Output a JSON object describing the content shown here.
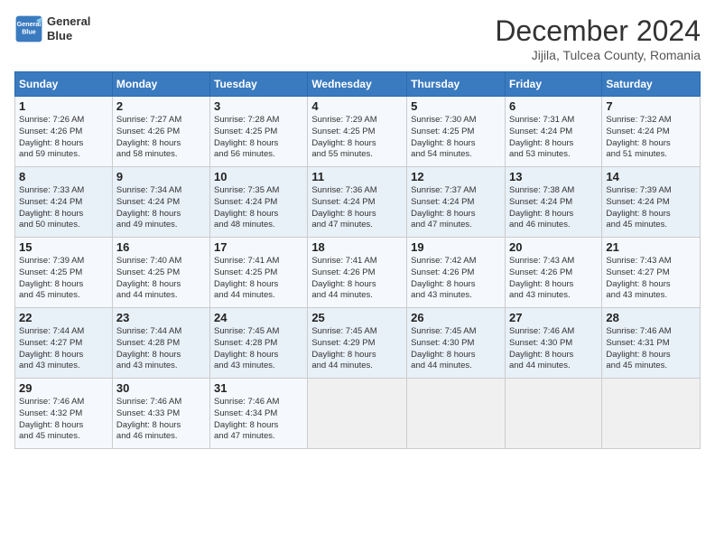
{
  "header": {
    "logo_line1": "General",
    "logo_line2": "Blue",
    "title": "December 2024",
    "subtitle": "Jijila, Tulcea County, Romania"
  },
  "days_of_week": [
    "Sunday",
    "Monday",
    "Tuesday",
    "Wednesday",
    "Thursday",
    "Friday",
    "Saturday"
  ],
  "weeks": [
    [
      {
        "day": "1",
        "info": "Sunrise: 7:26 AM\nSunset: 4:26 PM\nDaylight: 8 hours\nand 59 minutes."
      },
      {
        "day": "2",
        "info": "Sunrise: 7:27 AM\nSunset: 4:26 PM\nDaylight: 8 hours\nand 58 minutes."
      },
      {
        "day": "3",
        "info": "Sunrise: 7:28 AM\nSunset: 4:25 PM\nDaylight: 8 hours\nand 56 minutes."
      },
      {
        "day": "4",
        "info": "Sunrise: 7:29 AM\nSunset: 4:25 PM\nDaylight: 8 hours\nand 55 minutes."
      },
      {
        "day": "5",
        "info": "Sunrise: 7:30 AM\nSunset: 4:25 PM\nDaylight: 8 hours\nand 54 minutes."
      },
      {
        "day": "6",
        "info": "Sunrise: 7:31 AM\nSunset: 4:24 PM\nDaylight: 8 hours\nand 53 minutes."
      },
      {
        "day": "7",
        "info": "Sunrise: 7:32 AM\nSunset: 4:24 PM\nDaylight: 8 hours\nand 51 minutes."
      }
    ],
    [
      {
        "day": "8",
        "info": "Sunrise: 7:33 AM\nSunset: 4:24 PM\nDaylight: 8 hours\nand 50 minutes."
      },
      {
        "day": "9",
        "info": "Sunrise: 7:34 AM\nSunset: 4:24 PM\nDaylight: 8 hours\nand 49 minutes."
      },
      {
        "day": "10",
        "info": "Sunrise: 7:35 AM\nSunset: 4:24 PM\nDaylight: 8 hours\nand 48 minutes."
      },
      {
        "day": "11",
        "info": "Sunrise: 7:36 AM\nSunset: 4:24 PM\nDaylight: 8 hours\nand 47 minutes."
      },
      {
        "day": "12",
        "info": "Sunrise: 7:37 AM\nSunset: 4:24 PM\nDaylight: 8 hours\nand 47 minutes."
      },
      {
        "day": "13",
        "info": "Sunrise: 7:38 AM\nSunset: 4:24 PM\nDaylight: 8 hours\nand 46 minutes."
      },
      {
        "day": "14",
        "info": "Sunrise: 7:39 AM\nSunset: 4:24 PM\nDaylight: 8 hours\nand 45 minutes."
      }
    ],
    [
      {
        "day": "15",
        "info": "Sunrise: 7:39 AM\nSunset: 4:25 PM\nDaylight: 8 hours\nand 45 minutes."
      },
      {
        "day": "16",
        "info": "Sunrise: 7:40 AM\nSunset: 4:25 PM\nDaylight: 8 hours\nand 44 minutes."
      },
      {
        "day": "17",
        "info": "Sunrise: 7:41 AM\nSunset: 4:25 PM\nDaylight: 8 hours\nand 44 minutes."
      },
      {
        "day": "18",
        "info": "Sunrise: 7:41 AM\nSunset: 4:26 PM\nDaylight: 8 hours\nand 44 minutes."
      },
      {
        "day": "19",
        "info": "Sunrise: 7:42 AM\nSunset: 4:26 PM\nDaylight: 8 hours\nand 43 minutes."
      },
      {
        "day": "20",
        "info": "Sunrise: 7:43 AM\nSunset: 4:26 PM\nDaylight: 8 hours\nand 43 minutes."
      },
      {
        "day": "21",
        "info": "Sunrise: 7:43 AM\nSunset: 4:27 PM\nDaylight: 8 hours\nand 43 minutes."
      }
    ],
    [
      {
        "day": "22",
        "info": "Sunrise: 7:44 AM\nSunset: 4:27 PM\nDaylight: 8 hours\nand 43 minutes."
      },
      {
        "day": "23",
        "info": "Sunrise: 7:44 AM\nSunset: 4:28 PM\nDaylight: 8 hours\nand 43 minutes."
      },
      {
        "day": "24",
        "info": "Sunrise: 7:45 AM\nSunset: 4:28 PM\nDaylight: 8 hours\nand 43 minutes."
      },
      {
        "day": "25",
        "info": "Sunrise: 7:45 AM\nSunset: 4:29 PM\nDaylight: 8 hours\nand 44 minutes."
      },
      {
        "day": "26",
        "info": "Sunrise: 7:45 AM\nSunset: 4:30 PM\nDaylight: 8 hours\nand 44 minutes."
      },
      {
        "day": "27",
        "info": "Sunrise: 7:46 AM\nSunset: 4:30 PM\nDaylight: 8 hours\nand 44 minutes."
      },
      {
        "day": "28",
        "info": "Sunrise: 7:46 AM\nSunset: 4:31 PM\nDaylight: 8 hours\nand 45 minutes."
      }
    ],
    [
      {
        "day": "29",
        "info": "Sunrise: 7:46 AM\nSunset: 4:32 PM\nDaylight: 8 hours\nand 45 minutes."
      },
      {
        "day": "30",
        "info": "Sunrise: 7:46 AM\nSunset: 4:33 PM\nDaylight: 8 hours\nand 46 minutes."
      },
      {
        "day": "31",
        "info": "Sunrise: 7:46 AM\nSunset: 4:34 PM\nDaylight: 8 hours\nand 47 minutes."
      },
      {
        "day": "",
        "info": ""
      },
      {
        "day": "",
        "info": ""
      },
      {
        "day": "",
        "info": ""
      },
      {
        "day": "",
        "info": ""
      }
    ]
  ]
}
